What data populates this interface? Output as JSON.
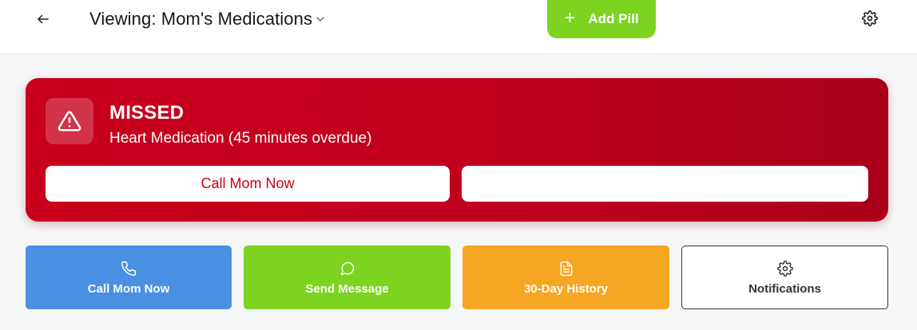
{
  "header": {
    "title": "Viewing: Mom's Medications",
    "add_label": "Add Pill"
  },
  "alert": {
    "status": "MISSED",
    "message": "Heart Medication (45 minutes overdue)",
    "primary_action": "Call Mom Now",
    "secondary_action": ""
  },
  "quick_actions": [
    {
      "label": "Call Mom Now",
      "icon": "phone-icon",
      "color": "#4a90e2"
    },
    {
      "label": "Send Message",
      "icon": "message-circle-icon",
      "color": "#7ed321"
    },
    {
      "label": "30-Day History",
      "icon": "file-text-icon",
      "color": "#f5a623"
    },
    {
      "label": "Notifications",
      "icon": "gear-icon",
      "color": "#ffffff"
    }
  ],
  "colors": {
    "accent_green": "#7ed321",
    "alert_red": "#c8001c",
    "blue": "#4a90e2",
    "orange": "#f5a623"
  }
}
